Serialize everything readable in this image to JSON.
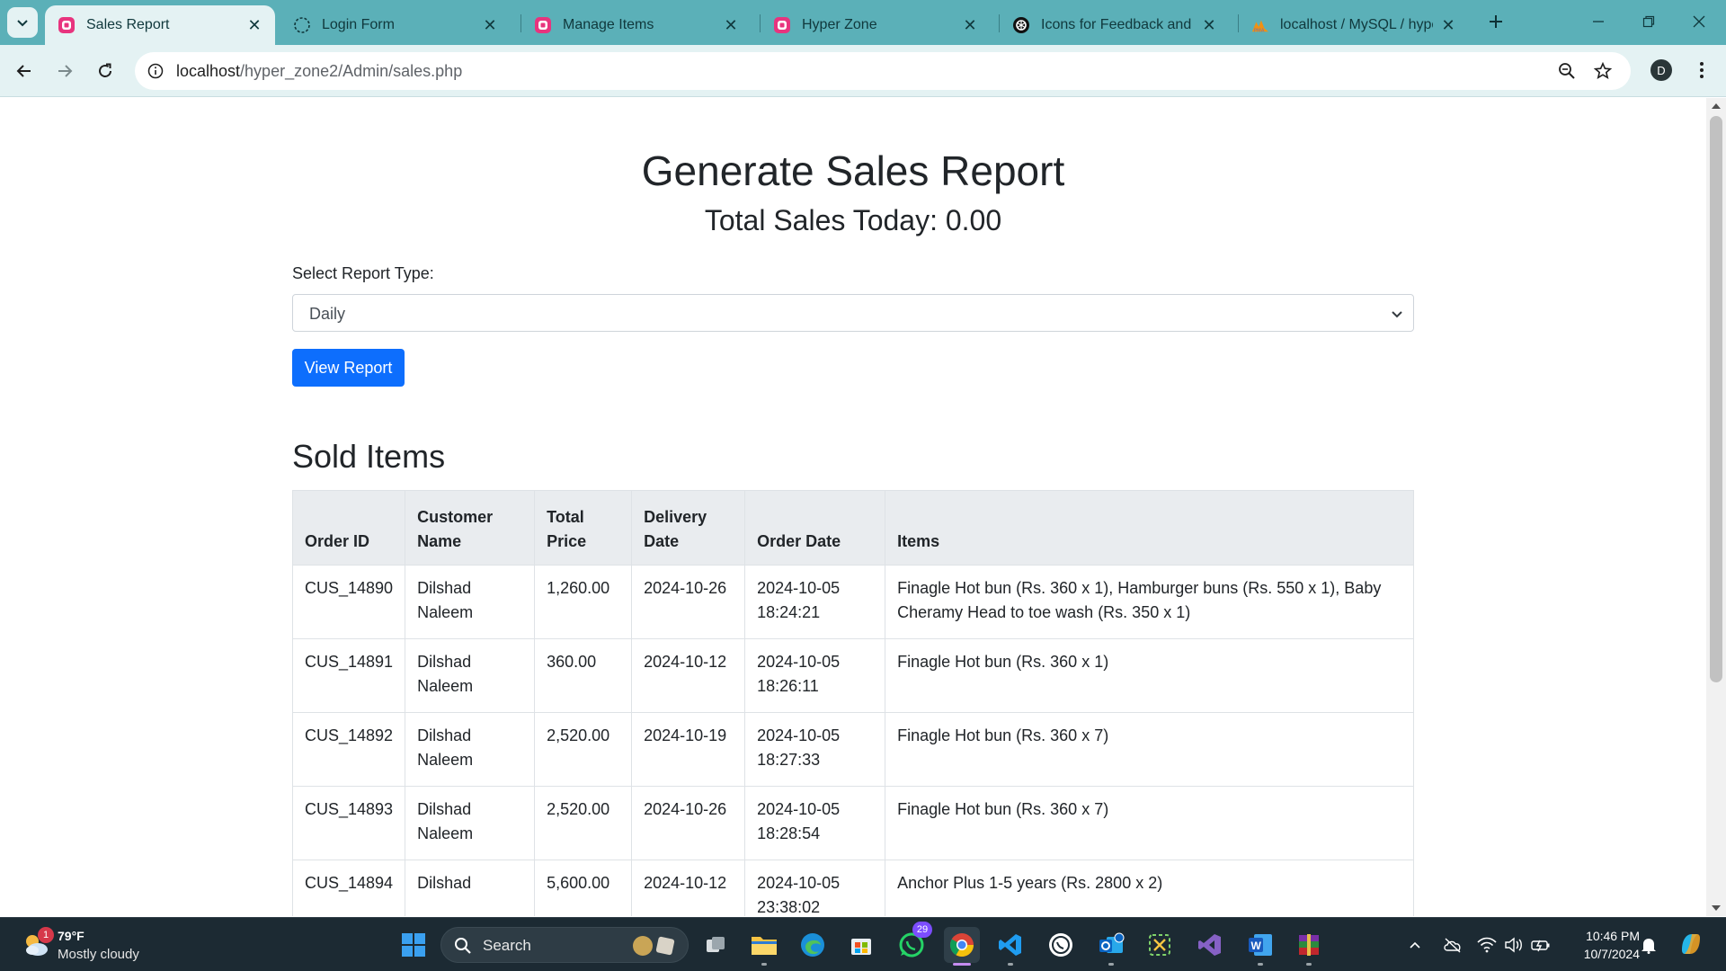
{
  "browser": {
    "tabs": [
      {
        "label": "Sales Report",
        "active": true
      },
      {
        "label": "Login Form",
        "active": false
      },
      {
        "label": "Manage Items",
        "active": false
      },
      {
        "label": "Hyper Zone",
        "active": false
      },
      {
        "label": "Icons for Feedback and Co",
        "active": false
      },
      {
        "label": "localhost / MySQL / hyper",
        "active": false
      }
    ],
    "url_host": "localhost",
    "url_path": "/hyper_zone2/Admin/sales.php",
    "profile_initial": "D",
    "accent_color": "#5bb0b8"
  },
  "page": {
    "title": "Generate Sales Report",
    "total_sales": "Total Sales Today: 0.00",
    "select_label": "Select Report Type:",
    "select_value": "Daily",
    "view_button": "View Report",
    "section_title": "Sold Items",
    "button_color": "#0d6efd"
  },
  "table": {
    "headers": [
      "Order ID",
      "Customer Name",
      "Total Price",
      "Delivery Date",
      "Order Date",
      "Items"
    ],
    "rows": [
      [
        "CUS_14890",
        "Dilshad Naleem",
        "1,260.00",
        "2024-10-26",
        "2024-10-05 18:24:21",
        "Finagle Hot bun (Rs. 360 x 1), Hamburger buns (Rs. 550 x 1), Baby Cheramy Head to toe wash (Rs. 350 x 1)"
      ],
      [
        "CUS_14891",
        "Dilshad Naleem",
        "360.00",
        "2024-10-12",
        "2024-10-05 18:26:11",
        "Finagle Hot bun (Rs. 360 x 1)"
      ],
      [
        "CUS_14892",
        "Dilshad Naleem",
        "2,520.00",
        "2024-10-19",
        "2024-10-05 18:27:33",
        "Finagle Hot bun (Rs. 360 x 7)"
      ],
      [
        "CUS_14893",
        "Dilshad Naleem",
        "2,520.00",
        "2024-10-26",
        "2024-10-05 18:28:54",
        "Finagle Hot bun (Rs. 360 x 7)"
      ],
      [
        "CUS_14894",
        "Dilshad",
        "5,600.00",
        "2024-10-12",
        "2024-10-05 23:38:02",
        "Anchor Plus 1-5 years (Rs. 2800 x 2)"
      ]
    ]
  },
  "taskbar": {
    "weather_badge": "1",
    "temperature": "79°F",
    "condition": "Mostly cloudy",
    "search_label": "Search",
    "whatsapp_badge": "29",
    "time": "10:46 PM",
    "date": "10/7/2024"
  }
}
